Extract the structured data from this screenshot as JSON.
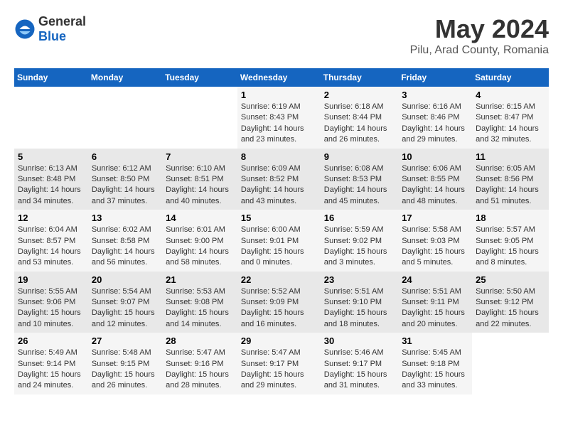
{
  "header": {
    "logo_general": "General",
    "logo_blue": "Blue",
    "month_title": "May 2024",
    "location": "Pilu, Arad County, Romania"
  },
  "days_of_week": [
    "Sunday",
    "Monday",
    "Tuesday",
    "Wednesday",
    "Thursday",
    "Friday",
    "Saturday"
  ],
  "weeks": [
    [
      {
        "day": "",
        "sunrise": "",
        "sunset": "",
        "daylight": ""
      },
      {
        "day": "",
        "sunrise": "",
        "sunset": "",
        "daylight": ""
      },
      {
        "day": "",
        "sunrise": "",
        "sunset": "",
        "daylight": ""
      },
      {
        "day": "1",
        "sunrise": "Sunrise: 6:19 AM",
        "sunset": "Sunset: 8:43 PM",
        "daylight": "Daylight: 14 hours and 23 minutes."
      },
      {
        "day": "2",
        "sunrise": "Sunrise: 6:18 AM",
        "sunset": "Sunset: 8:44 PM",
        "daylight": "Daylight: 14 hours and 26 minutes."
      },
      {
        "day": "3",
        "sunrise": "Sunrise: 6:16 AM",
        "sunset": "Sunset: 8:46 PM",
        "daylight": "Daylight: 14 hours and 29 minutes."
      },
      {
        "day": "4",
        "sunrise": "Sunrise: 6:15 AM",
        "sunset": "Sunset: 8:47 PM",
        "daylight": "Daylight: 14 hours and 32 minutes."
      }
    ],
    [
      {
        "day": "5",
        "sunrise": "Sunrise: 6:13 AM",
        "sunset": "Sunset: 8:48 PM",
        "daylight": "Daylight: 14 hours and 34 minutes."
      },
      {
        "day": "6",
        "sunrise": "Sunrise: 6:12 AM",
        "sunset": "Sunset: 8:50 PM",
        "daylight": "Daylight: 14 hours and 37 minutes."
      },
      {
        "day": "7",
        "sunrise": "Sunrise: 6:10 AM",
        "sunset": "Sunset: 8:51 PM",
        "daylight": "Daylight: 14 hours and 40 minutes."
      },
      {
        "day": "8",
        "sunrise": "Sunrise: 6:09 AM",
        "sunset": "Sunset: 8:52 PM",
        "daylight": "Daylight: 14 hours and 43 minutes."
      },
      {
        "day": "9",
        "sunrise": "Sunrise: 6:08 AM",
        "sunset": "Sunset: 8:53 PM",
        "daylight": "Daylight: 14 hours and 45 minutes."
      },
      {
        "day": "10",
        "sunrise": "Sunrise: 6:06 AM",
        "sunset": "Sunset: 8:55 PM",
        "daylight": "Daylight: 14 hours and 48 minutes."
      },
      {
        "day": "11",
        "sunrise": "Sunrise: 6:05 AM",
        "sunset": "Sunset: 8:56 PM",
        "daylight": "Daylight: 14 hours and 51 minutes."
      }
    ],
    [
      {
        "day": "12",
        "sunrise": "Sunrise: 6:04 AM",
        "sunset": "Sunset: 8:57 PM",
        "daylight": "Daylight: 14 hours and 53 minutes."
      },
      {
        "day": "13",
        "sunrise": "Sunrise: 6:02 AM",
        "sunset": "Sunset: 8:58 PM",
        "daylight": "Daylight: 14 hours and 56 minutes."
      },
      {
        "day": "14",
        "sunrise": "Sunrise: 6:01 AM",
        "sunset": "Sunset: 9:00 PM",
        "daylight": "Daylight: 14 hours and 58 minutes."
      },
      {
        "day": "15",
        "sunrise": "Sunrise: 6:00 AM",
        "sunset": "Sunset: 9:01 PM",
        "daylight": "Daylight: 15 hours and 0 minutes."
      },
      {
        "day": "16",
        "sunrise": "Sunrise: 5:59 AM",
        "sunset": "Sunset: 9:02 PM",
        "daylight": "Daylight: 15 hours and 3 minutes."
      },
      {
        "day": "17",
        "sunrise": "Sunrise: 5:58 AM",
        "sunset": "Sunset: 9:03 PM",
        "daylight": "Daylight: 15 hours and 5 minutes."
      },
      {
        "day": "18",
        "sunrise": "Sunrise: 5:57 AM",
        "sunset": "Sunset: 9:05 PM",
        "daylight": "Daylight: 15 hours and 8 minutes."
      }
    ],
    [
      {
        "day": "19",
        "sunrise": "Sunrise: 5:55 AM",
        "sunset": "Sunset: 9:06 PM",
        "daylight": "Daylight: 15 hours and 10 minutes."
      },
      {
        "day": "20",
        "sunrise": "Sunrise: 5:54 AM",
        "sunset": "Sunset: 9:07 PM",
        "daylight": "Daylight: 15 hours and 12 minutes."
      },
      {
        "day": "21",
        "sunrise": "Sunrise: 5:53 AM",
        "sunset": "Sunset: 9:08 PM",
        "daylight": "Daylight: 15 hours and 14 minutes."
      },
      {
        "day": "22",
        "sunrise": "Sunrise: 5:52 AM",
        "sunset": "Sunset: 9:09 PM",
        "daylight": "Daylight: 15 hours and 16 minutes."
      },
      {
        "day": "23",
        "sunrise": "Sunrise: 5:51 AM",
        "sunset": "Sunset: 9:10 PM",
        "daylight": "Daylight: 15 hours and 18 minutes."
      },
      {
        "day": "24",
        "sunrise": "Sunrise: 5:51 AM",
        "sunset": "Sunset: 9:11 PM",
        "daylight": "Daylight: 15 hours and 20 minutes."
      },
      {
        "day": "25",
        "sunrise": "Sunrise: 5:50 AM",
        "sunset": "Sunset: 9:12 PM",
        "daylight": "Daylight: 15 hours and 22 minutes."
      }
    ],
    [
      {
        "day": "26",
        "sunrise": "Sunrise: 5:49 AM",
        "sunset": "Sunset: 9:14 PM",
        "daylight": "Daylight: 15 hours and 24 minutes."
      },
      {
        "day": "27",
        "sunrise": "Sunrise: 5:48 AM",
        "sunset": "Sunset: 9:15 PM",
        "daylight": "Daylight: 15 hours and 26 minutes."
      },
      {
        "day": "28",
        "sunrise": "Sunrise: 5:47 AM",
        "sunset": "Sunset: 9:16 PM",
        "daylight": "Daylight: 15 hours and 28 minutes."
      },
      {
        "day": "29",
        "sunrise": "Sunrise: 5:47 AM",
        "sunset": "Sunset: 9:17 PM",
        "daylight": "Daylight: 15 hours and 29 minutes."
      },
      {
        "day": "30",
        "sunrise": "Sunrise: 5:46 AM",
        "sunset": "Sunset: 9:17 PM",
        "daylight": "Daylight: 15 hours and 31 minutes."
      },
      {
        "day": "31",
        "sunrise": "Sunrise: 5:45 AM",
        "sunset": "Sunset: 9:18 PM",
        "daylight": "Daylight: 15 hours and 33 minutes."
      },
      {
        "day": "",
        "sunrise": "",
        "sunset": "",
        "daylight": ""
      }
    ]
  ]
}
